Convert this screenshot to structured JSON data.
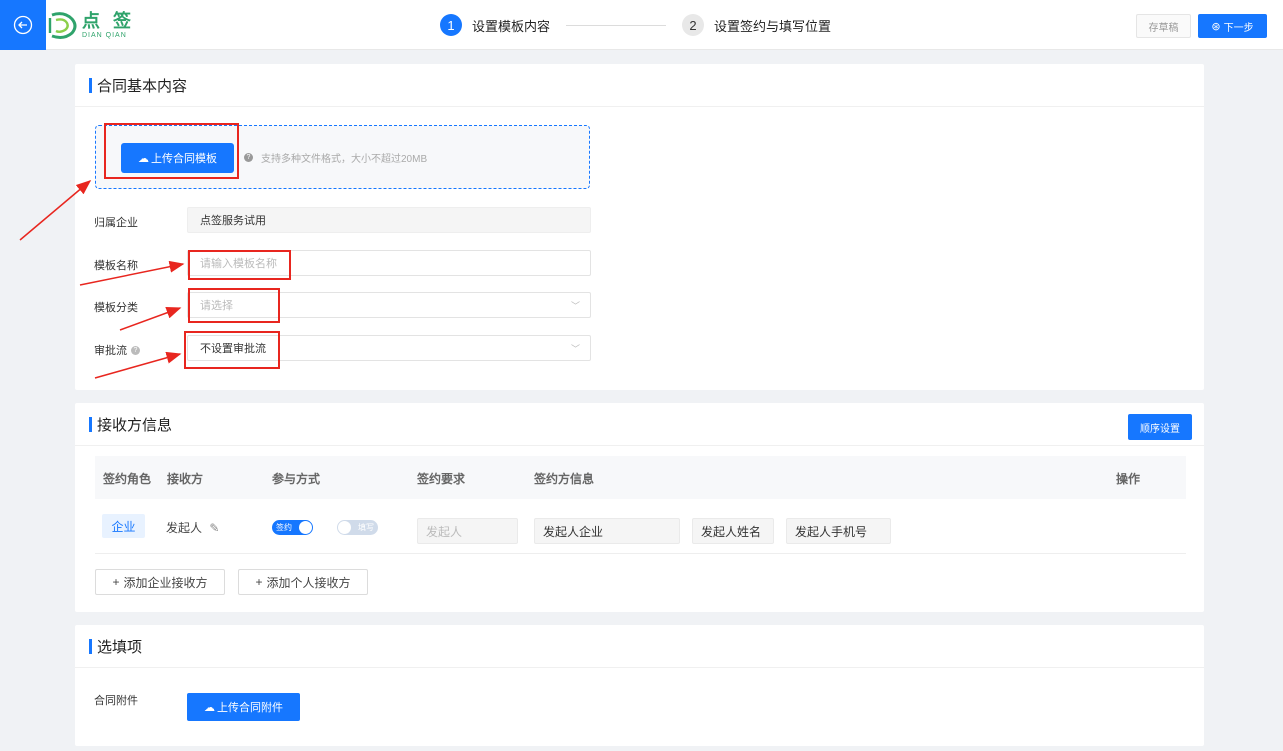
{
  "header": {
    "logo_cn": "点 签",
    "logo_en": "DIAN QIAN",
    "steps": [
      {
        "num": "1",
        "label": "设置模板内容"
      },
      {
        "num": "2",
        "label": "设置签约与填写位置"
      }
    ],
    "draft_label": "存草稿",
    "next_label": "下一步"
  },
  "basic": {
    "title": "合同基本内容",
    "upload_label": "上传合同模板",
    "upload_hint": "支持多种文件格式，大小不超过20MB",
    "fields": {
      "company_label": "归属企业",
      "company_value": "点签服务试用",
      "name_label": "模板名称",
      "name_placeholder": "请输入模板名称",
      "category_label": "模板分类",
      "category_placeholder": "请选择",
      "approval_label": "审批流",
      "approval_value": "不设置审批流"
    }
  },
  "recipients": {
    "title": "接收方信息",
    "order_label": "顺序设置",
    "columns": [
      "签约角色",
      "接收方",
      "参与方式",
      "签约要求",
      "签约方信息",
      "操作"
    ],
    "row": {
      "role": "企业",
      "recipient": "发起人",
      "toggle_sign": "签约",
      "toggle_fill": "填写",
      "requirement": "发起人",
      "company": "发起人企业",
      "name": "发起人姓名",
      "phone": "发起人手机号"
    },
    "add_company": "添加企业接收方",
    "add_person": "添加个人接收方"
  },
  "optional": {
    "title": "选填项",
    "attach_label": "合同附件",
    "attach_button": "上传合同附件"
  },
  "colors": {
    "primary": "#1677ff",
    "annotation": "#e8261f",
    "brand": "#2fa36b"
  }
}
